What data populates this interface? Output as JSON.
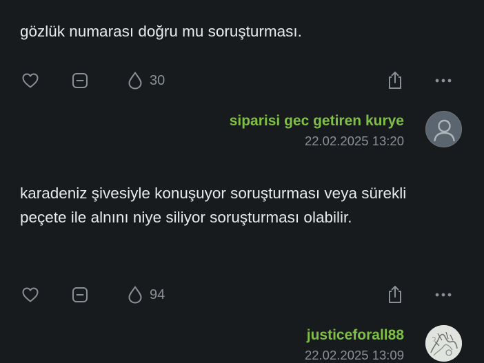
{
  "entries": [
    {
      "text": "gözlük numarası doğru mu soruşturması.",
      "favorite_count": "30",
      "author": "siparisi gec getiren kurye",
      "date": "22.02.2025 13:20",
      "avatar": "default-user-icon"
    },
    {
      "text": "karadeniz şivesiyle konuşuyor soruşturması veya sürekli peçete ile alnını niye siliyor soruşturması olabilir.",
      "favorite_count": "94",
      "author": "justiceforall88",
      "date": "22.02.2025 13:09",
      "avatar": "sketch-photo"
    }
  ],
  "colors": {
    "background": "#181b1d",
    "author": "#7fbf45",
    "icon": "#8b9096",
    "text": "#e8e9ea"
  }
}
